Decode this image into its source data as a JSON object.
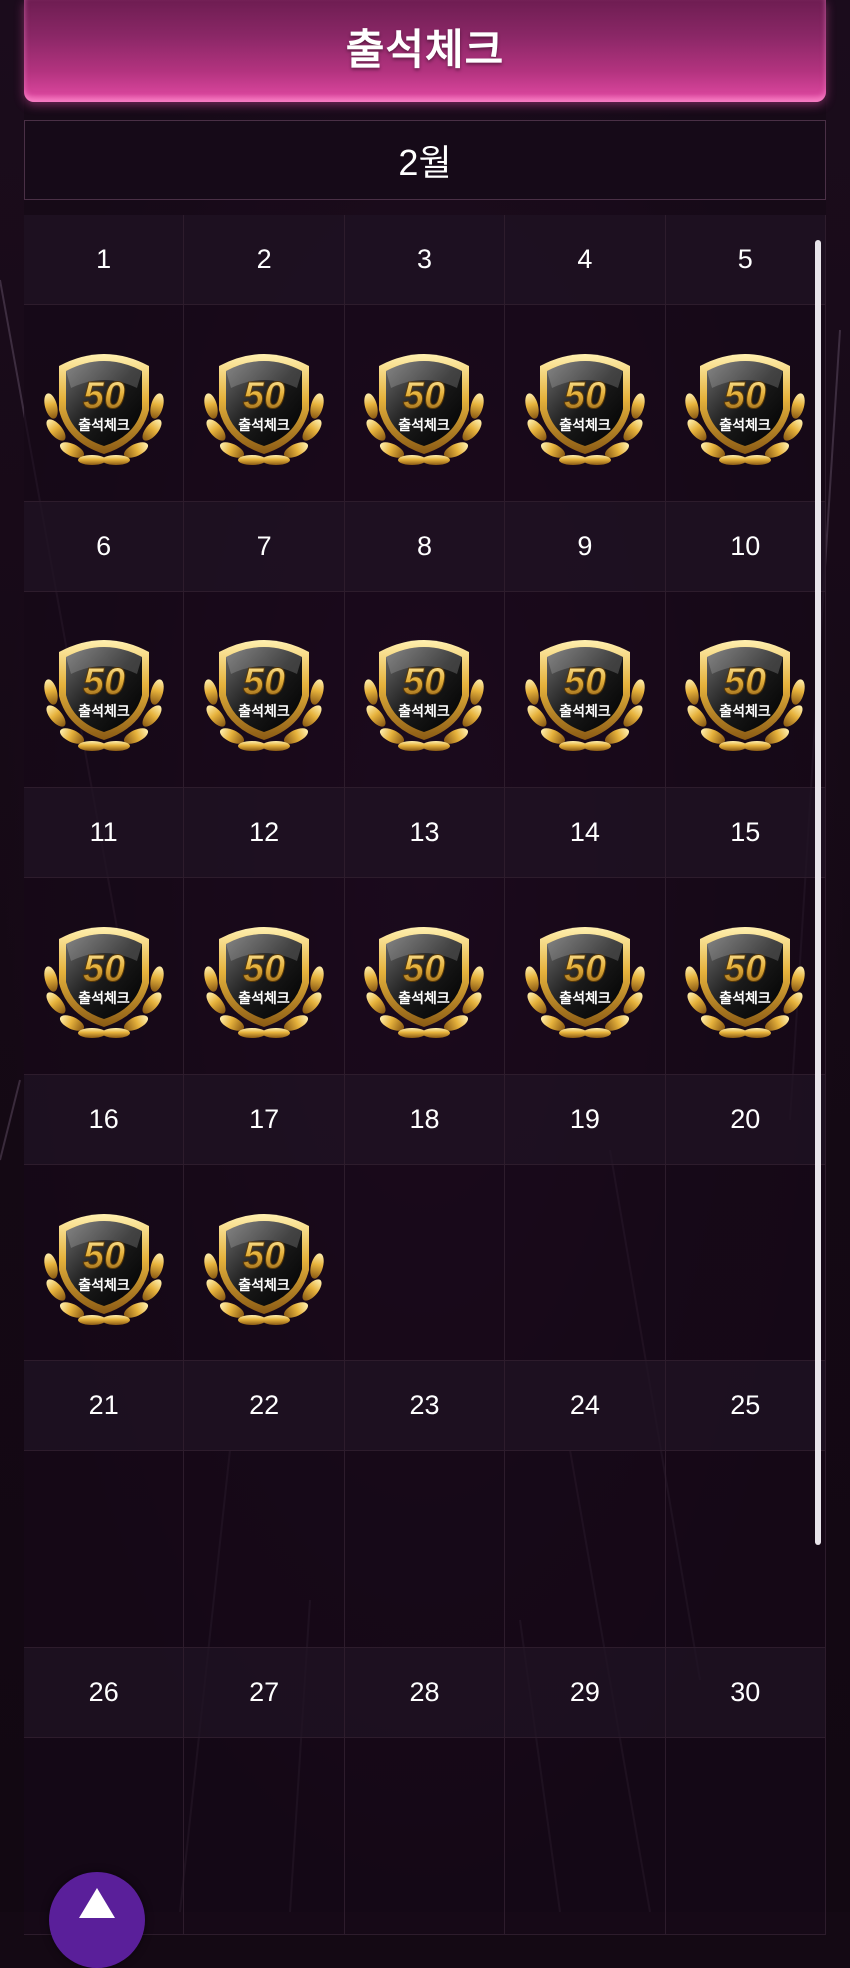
{
  "header": {
    "title": "출석체크"
  },
  "month": {
    "label": "2월"
  },
  "badge": {
    "number": "50",
    "label": "출석체크"
  },
  "calendar": {
    "weeks": [
      {
        "days": [
          "1",
          "2",
          "3",
          "4",
          "5"
        ],
        "stamped": [
          true,
          true,
          true,
          true,
          true
        ]
      },
      {
        "days": [
          "6",
          "7",
          "8",
          "9",
          "10"
        ],
        "stamped": [
          true,
          true,
          true,
          true,
          true
        ]
      },
      {
        "days": [
          "11",
          "12",
          "13",
          "14",
          "15"
        ],
        "stamped": [
          true,
          true,
          true,
          true,
          true
        ]
      },
      {
        "days": [
          "16",
          "17",
          "18",
          "19",
          "20"
        ],
        "stamped": [
          true,
          true,
          false,
          false,
          false
        ]
      },
      {
        "days": [
          "21",
          "22",
          "23",
          "24",
          "25"
        ],
        "stamped": [
          false,
          false,
          false,
          false,
          false
        ]
      },
      {
        "days": [
          "26",
          "27",
          "28",
          "29",
          "30"
        ],
        "stamped": [
          false,
          false,
          false,
          false,
          false
        ]
      }
    ]
  },
  "icons": {
    "stamp": "attendance-badge-icon",
    "scroll_top": "arrow-up-icon"
  },
  "colors": {
    "header_accent": "#d6449a",
    "scroll_top_button": "#5a1f9a",
    "badge_gold": "#e6b23c"
  }
}
